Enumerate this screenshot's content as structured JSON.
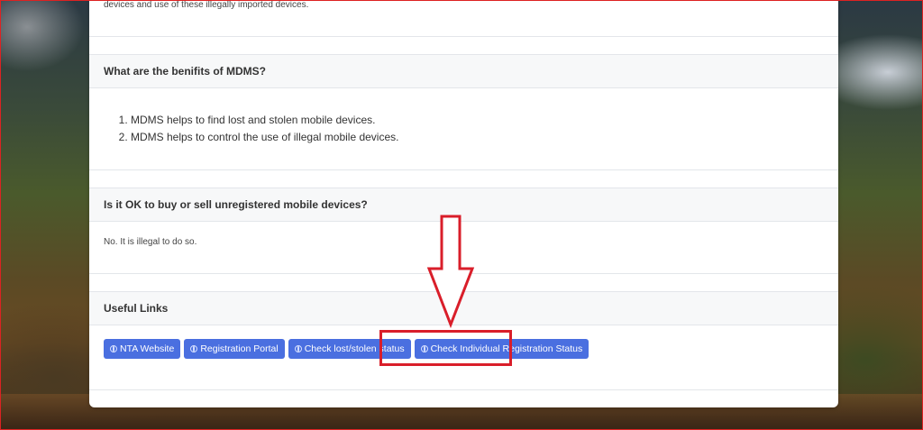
{
  "intro": {
    "trailing_text": "devices and use of these illegally imported devices."
  },
  "faq": [
    {
      "question": "What are the benifits of MDMS?",
      "answers": [
        "MDMS helps to find lost and stolen mobile devices.",
        "MDMS helps to control the use of illegal mobile devices."
      ]
    },
    {
      "question": "Is it OK to buy or sell unregistered mobile devices?",
      "answer": "No. It is illegal to do so."
    }
  ],
  "useful_links": {
    "title": "Useful Links",
    "buttons": [
      {
        "label": "NTA Website",
        "icon": "globe-icon"
      },
      {
        "label": "Registration Portal",
        "icon": "globe-icon"
      },
      {
        "label": "Check lost/stolen status",
        "icon": "globe-icon"
      },
      {
        "label": "Check Individual Registration Status",
        "icon": "globe-icon"
      }
    ]
  },
  "colors": {
    "button": "#4a6fe0",
    "annotation": "#d91e2a",
    "header_bg": "#f7f8f9"
  }
}
